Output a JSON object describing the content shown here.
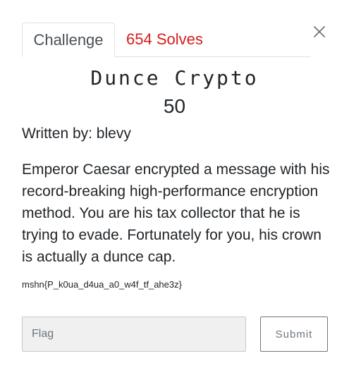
{
  "tabs": {
    "challenge_label": "Challenge",
    "solves_label": "654 Solves"
  },
  "challenge": {
    "name": "Dunce Crypto",
    "value": "50",
    "author": "Written by: blevy",
    "description": "Emperor Caesar encrypted a message with his record-breaking high-performance encryption method. You are his tax collector that he is trying to evade. Fortunately for you, his crown is actually a dunce cap.",
    "ciphertext": "mshn{P_k0ua_d4ua_a0_w4f_tf_ahe3z}"
  },
  "form": {
    "flag_placeholder": "Flag",
    "flag_value": "",
    "submit_label": "Submit"
  },
  "icons": {
    "close": "close-icon"
  },
  "colors": {
    "solves_accent": "#d61d1d",
    "input_background": "#f0f0f0",
    "button_border": "#6c757d"
  }
}
